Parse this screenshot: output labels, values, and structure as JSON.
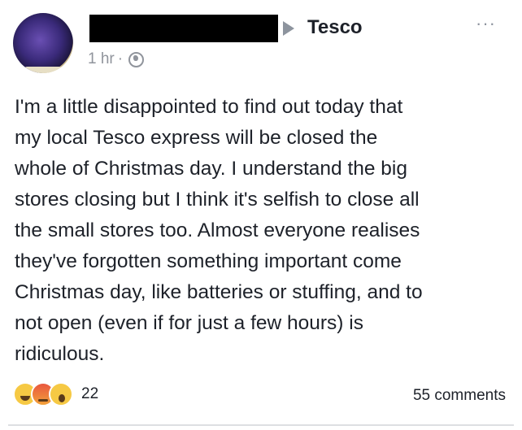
{
  "post": {
    "page_name": "Tesco",
    "timestamp": "1 hr",
    "separator": "·",
    "body": "I'm a little disappointed to find out today that\nmy local Tesco express will be closed the\nwhole of Christmas day. I understand the big\nstores closing but I think it's selfish to close all\nthe small stores too. Almost everyone realises\nthey've forgotten something important come\nChristmas day, like batteries or stuffing, and to\nnot open (even if for just a few hours) is\nridiculous.",
    "more_label": "···"
  },
  "footer": {
    "reaction_icons": [
      "haha-icon",
      "angry-icon",
      "wow-icon"
    ],
    "reaction_count": "22",
    "comments": "55 comments"
  },
  "colors": {
    "text": "#1d2129",
    "meta": "#90949c",
    "redaction": "#000000"
  }
}
